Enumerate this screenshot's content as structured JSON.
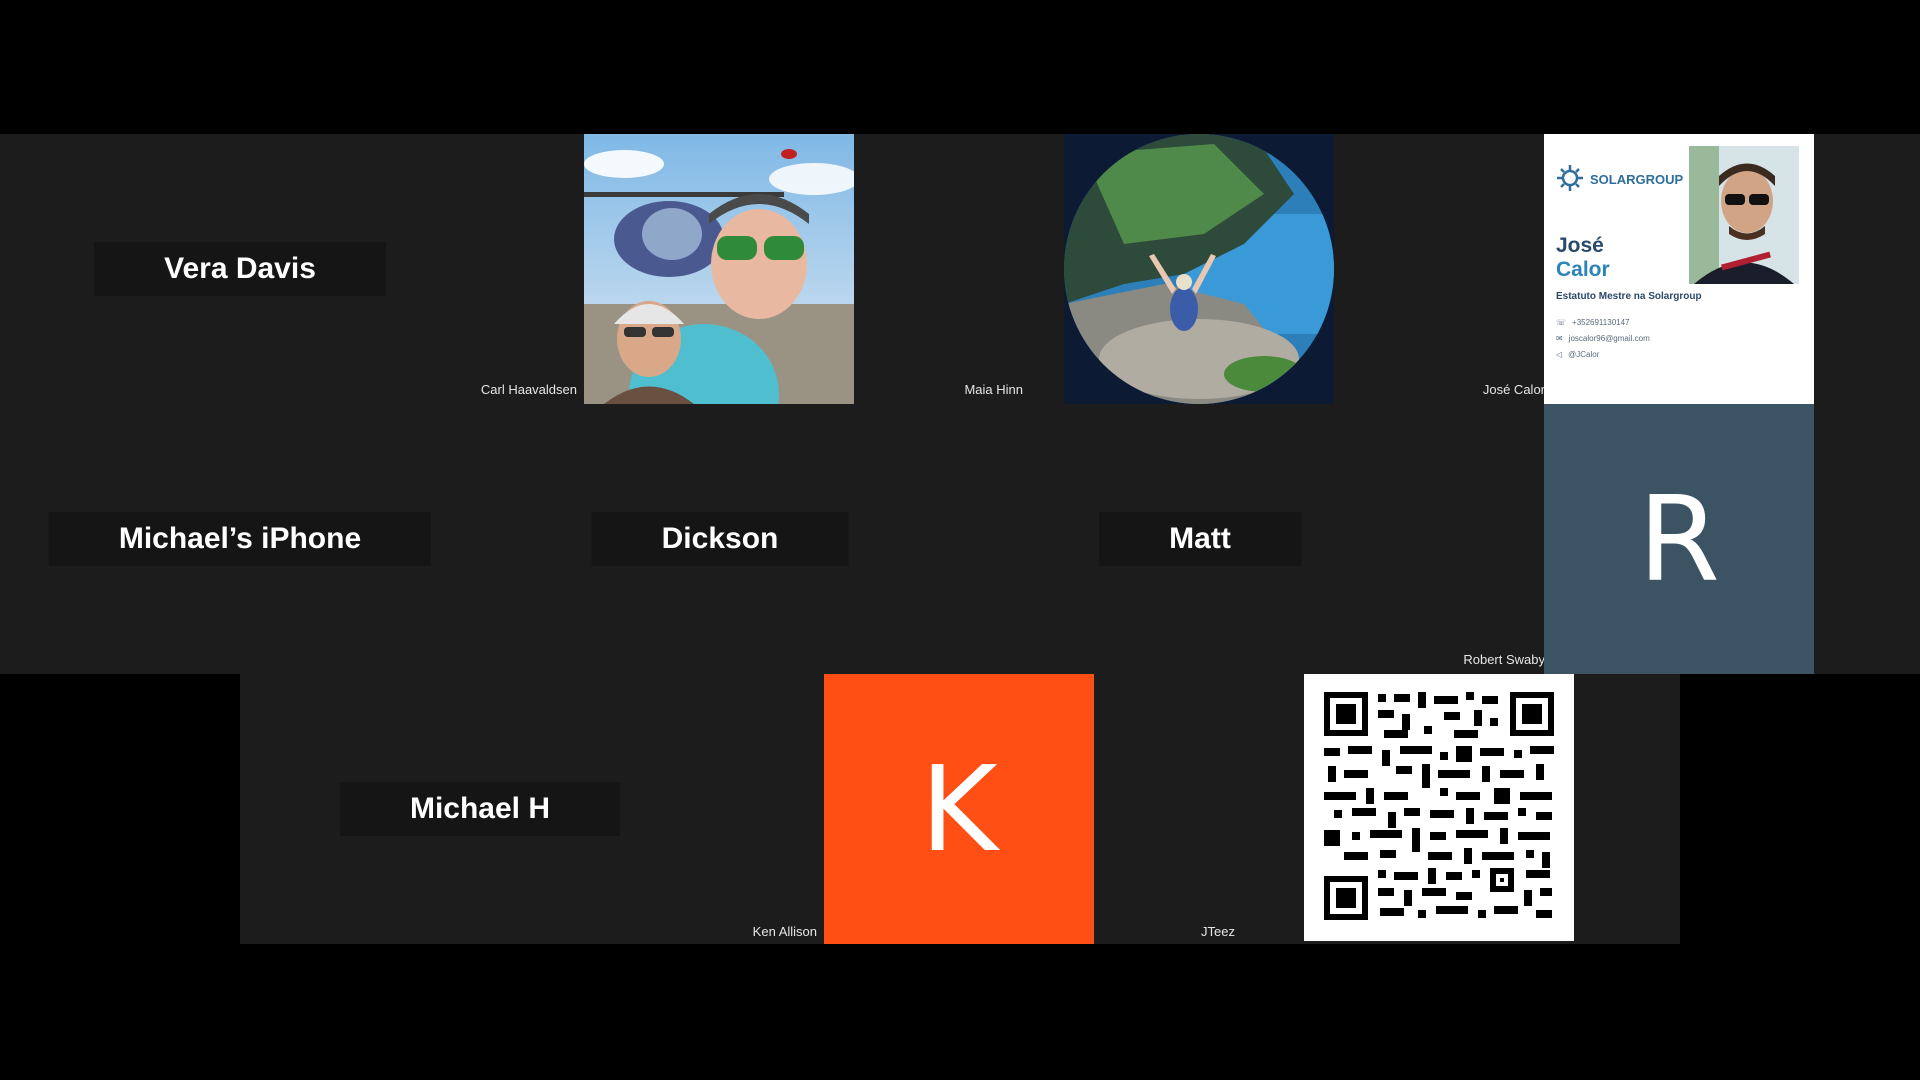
{
  "participants": {
    "vera": {
      "name": "Vera Davis"
    },
    "carl": {
      "name": "Carl Haavaldsen"
    },
    "maia": {
      "name": "Maia Hinn"
    },
    "jose": {
      "name": "José Calor"
    },
    "michaels_iphone": {
      "name": "Michael’s iPhone"
    },
    "dickson": {
      "name": "Dickson"
    },
    "matt": {
      "name": "Matt"
    },
    "robert": {
      "name": "Robert Swaby",
      "avatar_letter": "R",
      "avatar_color": "#3c5364"
    },
    "michael_h": {
      "name": "Michael H"
    },
    "ken": {
      "name": "Ken Allison",
      "avatar_letter": "K",
      "avatar_color": "#ff4f14"
    },
    "jteez": {
      "name": "JTeez"
    }
  },
  "business_card": {
    "brand": "SOLARGROUP",
    "first_name": "José",
    "last_name": "Calor",
    "role": "Estatuto Mestre na Solargroup",
    "phone": "+352691130147",
    "email": "joscalor96@gmail.com",
    "handle": "@JCalor"
  },
  "colors": {
    "background": "#000000",
    "tile": "#1c1c1c",
    "name_plate": "#151515"
  }
}
